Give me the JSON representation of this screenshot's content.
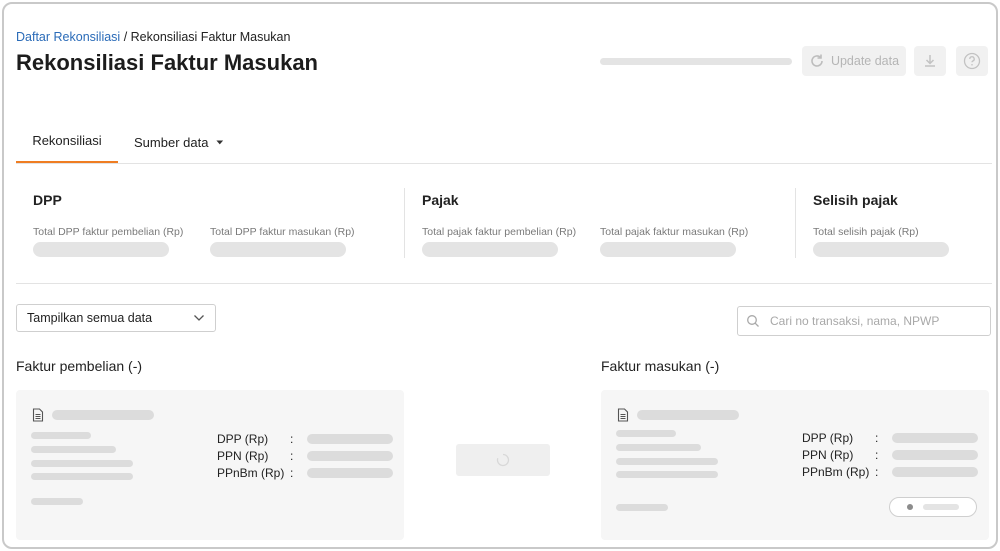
{
  "breadcrumb": {
    "parent": "Daftar Rekonsiliasi",
    "separator": " / ",
    "current": "Rekonsiliasi Faktur Masukan"
  },
  "page_title": "Rekonsiliasi Faktur Masukan",
  "toolbar": {
    "update_label": "Update data",
    "update_icon": "refresh-icon",
    "download_icon": "download-icon",
    "help_icon": "help-icon"
  },
  "tabs": [
    {
      "label": "Rekonsiliasi"
    },
    {
      "label": "Sumber data",
      "icon": "caret-down-icon"
    }
  ],
  "summary": {
    "dpp": {
      "title": "DPP",
      "label_a": "Total DPP faktur pembelian (Rp)",
      "label_b": "Total DPP faktur masukan (Rp)"
    },
    "pajak": {
      "title": "Pajak",
      "label_a": "Total pajak faktur pembelian (Rp)",
      "label_b": "Total pajak faktur masukan (Rp)"
    },
    "selisih": {
      "title": "Selisih pajak",
      "label_a": "Total selisih pajak (Rp)"
    }
  },
  "filter": {
    "selected": "Tampilkan semua data"
  },
  "search": {
    "placeholder": "Cari no transaksi, nama, NPWP"
  },
  "columns": {
    "left_title": "Faktur pembelian (-)",
    "right_title": "Faktur masukan (-)",
    "fields": [
      "DPP (Rp)",
      "PPN (Rp)",
      "PPnBm (Rp)"
    ],
    "colon": ":"
  },
  "colors": {
    "accent": "#ef7d22",
    "link": "#2a6bb8",
    "skeleton": "#e4e4e4"
  }
}
